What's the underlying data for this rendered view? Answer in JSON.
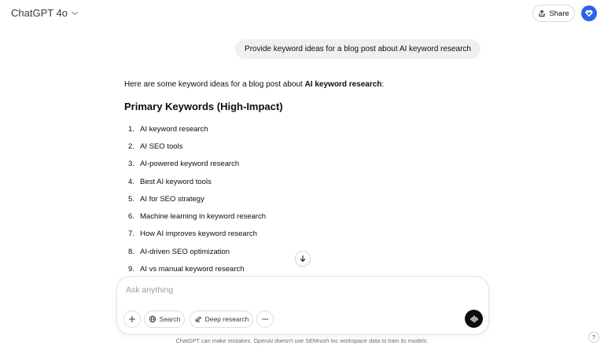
{
  "header": {
    "model_name": "ChatGPT 4o",
    "share_label": "Share"
  },
  "conversation": {
    "user_message": "Provide keyword ideas for a blog post about AI keyword research",
    "assistant": {
      "intro_prefix": "Here are some keyword ideas for a blog post about ",
      "intro_bold": "AI keyword research",
      "intro_suffix": ":",
      "heading": "Primary Keywords (High-Impact)",
      "keywords": [
        {
          "num": "1.",
          "text": "AI keyword research"
        },
        {
          "num": "2.",
          "text": "AI SEO tools"
        },
        {
          "num": "3.",
          "text": "AI-powered keyword research"
        },
        {
          "num": "4.",
          "text": "Best AI keyword tools"
        },
        {
          "num": "5.",
          "text": "AI for SEO strategy"
        },
        {
          "num": "6.",
          "text": "Machine learning in keyword research"
        },
        {
          "num": "7.",
          "text": "How AI improves keyword research"
        },
        {
          "num": "8.",
          "text": "AI-driven SEO optimization"
        },
        {
          "num": "9.",
          "text": "AI vs manual keyword research"
        }
      ]
    }
  },
  "composer": {
    "placeholder": "Ask anything",
    "value": "",
    "search_label": "Search",
    "deep_research_label": "Deep research"
  },
  "footer": {
    "disclaimer": "ChatGPT can make mistakes. OpenAI doesn't use SEMrush Inc workspace data to train its models.",
    "help_label": "?"
  },
  "icons": {
    "model_chevron": "chevron-down-icon",
    "share": "share-upload-icon",
    "avatar": "workspace-avatar-icon",
    "scroll_down": "arrow-down-icon",
    "add": "plus-icon",
    "search": "globe-icon",
    "deep_research": "telescope-icon",
    "more": "more-dots-icon",
    "voice": "voice-waveform-icon"
  },
  "colors": {
    "accent": "#2f62ea",
    "user_bubble": "#f0f0f0",
    "voice_button": "#0d0d0d"
  }
}
